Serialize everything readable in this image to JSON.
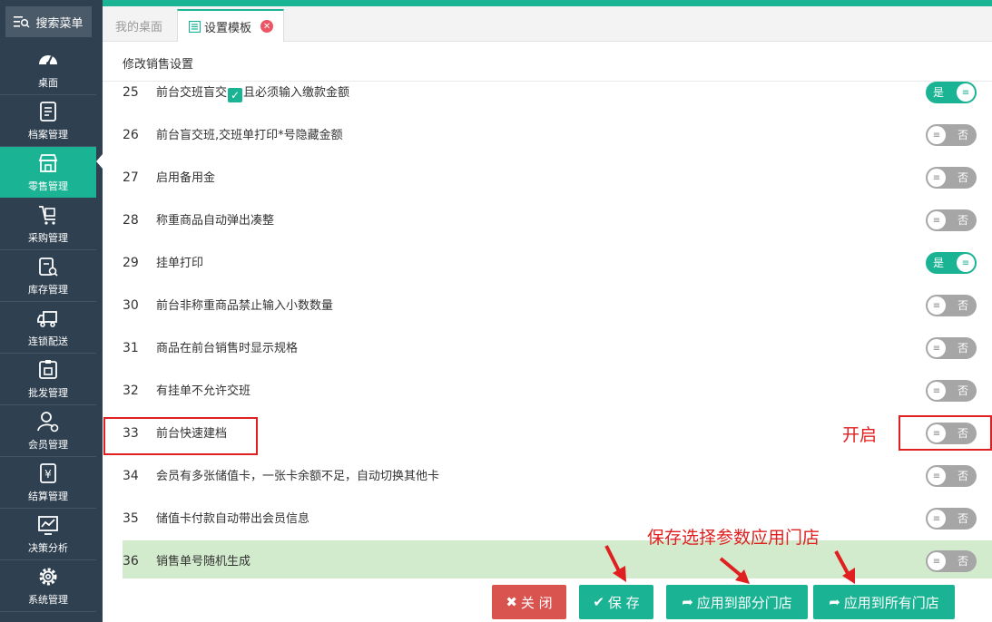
{
  "sidebar": {
    "search_label": "搜索菜单",
    "items": [
      {
        "label": "桌面",
        "icon": "dashboard-icon",
        "active": false
      },
      {
        "label": "档案管理",
        "icon": "file-icon",
        "active": false
      },
      {
        "label": "零售管理",
        "icon": "store-icon",
        "active": true
      },
      {
        "label": "采购管理",
        "icon": "cart-icon",
        "active": false
      },
      {
        "label": "库存管理",
        "icon": "inventory-icon",
        "active": false
      },
      {
        "label": "连锁配送",
        "icon": "truck-icon",
        "active": false
      },
      {
        "label": "批发管理",
        "icon": "wholesale-icon",
        "active": false
      },
      {
        "label": "会员管理",
        "icon": "member-icon",
        "active": false
      },
      {
        "label": "结算管理",
        "icon": "settlement-icon",
        "active": false
      },
      {
        "label": "决策分析",
        "icon": "chart-icon",
        "active": false
      },
      {
        "label": "系统管理",
        "icon": "gear-icon",
        "active": false
      }
    ]
  },
  "tabs": {
    "desktop": "我的桌面",
    "settings": "设置模板"
  },
  "page_title": "修改销售设置",
  "settings": [
    {
      "num": "25",
      "text_before": "前台交班盲交",
      "has_check": true,
      "text_after": "且必须输入缴款金额",
      "on": true
    },
    {
      "num": "26",
      "text_before": "前台盲交班,交班单打印*号隐藏金额",
      "has_check": false,
      "text_after": "",
      "on": false
    },
    {
      "num": "27",
      "text_before": "启用备用金",
      "has_check": false,
      "text_after": "",
      "on": false
    },
    {
      "num": "28",
      "text_before": "称重商品自动弹出凑整",
      "has_check": false,
      "text_after": "",
      "on": false
    },
    {
      "num": "29",
      "text_before": "挂单打印",
      "has_check": false,
      "text_after": "",
      "on": true
    },
    {
      "num": "30",
      "text_before": "前台非称重商品禁止输入小数数量",
      "has_check": false,
      "text_after": "",
      "on": false
    },
    {
      "num": "31",
      "text_before": "商品在前台销售时显示规格",
      "has_check": false,
      "text_after": "",
      "on": false
    },
    {
      "num": "32",
      "text_before": "有挂单不允许交班",
      "has_check": false,
      "text_after": "",
      "on": false
    },
    {
      "num": "33",
      "text_before": "前台快速建档",
      "has_check": false,
      "text_after": "",
      "on": false
    },
    {
      "num": "34",
      "text_before": "会员有多张储值卡，一张卡余额不足，自动切换其他卡",
      "has_check": false,
      "text_after": "",
      "on": false
    },
    {
      "num": "35",
      "text_before": "储值卡付款自动带出会员信息",
      "has_check": false,
      "text_after": "",
      "on": false
    },
    {
      "num": "36",
      "text_before": "销售单号随机生成",
      "has_check": false,
      "text_after": "",
      "on": false,
      "highlight": true
    }
  ],
  "toggle_labels": {
    "on": "是",
    "off": "否"
  },
  "annotations": {
    "open_hint": "开启",
    "apply_hint": "保存选择参数应用门店"
  },
  "buttons": {
    "close": "关 闭",
    "save": "保 存",
    "apply_some": "应用到部分门店",
    "apply_all": "应用到所有门店"
  },
  "colors": {
    "sidebar": "#2f4050",
    "accent": "#1ab394",
    "danger": "#d9534f",
    "annotation": "#e02020",
    "highlight_row": "#d3ebcd"
  }
}
